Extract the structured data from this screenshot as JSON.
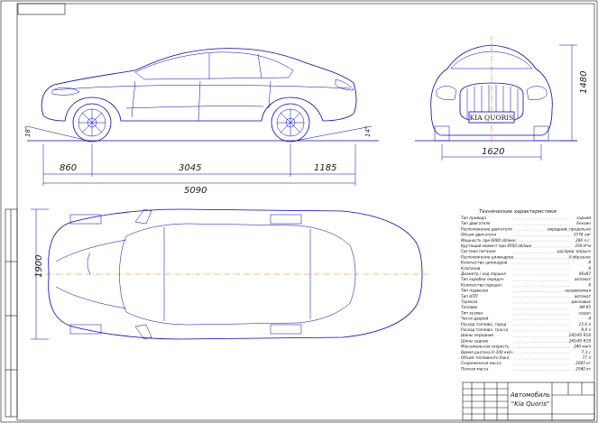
{
  "dimensions": {
    "front_overhang": "860",
    "wheelbase": "3045",
    "rear_overhang": "1185",
    "overall_length": "5090",
    "track": "1620",
    "height": "1480",
    "width": "1900",
    "approach_angle": "18°",
    "departure_angle": "14°"
  },
  "front_view": {
    "plate_text": "KIA QUORIS"
  },
  "specs": {
    "title": "Технические характеристики",
    "rows": [
      {
        "label": "Тип привода",
        "value": "задний"
      },
      {
        "label": "Тип двигателя",
        "value": "бензин"
      },
      {
        "label": "Расположение двигателя",
        "value": "передний, продольно"
      },
      {
        "label": "Объем двигателя",
        "value": "3778 см³"
      },
      {
        "label": "Мощность при 6000 об/мин",
        "value": "290 л.с."
      },
      {
        "label": "Крутящий момент при 4500 об/мин",
        "value": "358 Н*м"
      },
      {
        "label": "Система питания",
        "value": "распред. впрыск"
      },
      {
        "label": "Расположение цилиндров",
        "value": "V-образное"
      },
      {
        "label": "Количество цилиндров",
        "value": "8"
      },
      {
        "label": "Клапанов",
        "value": "4"
      },
      {
        "label": "Диаметр / ход поршня",
        "value": "96x87"
      },
      {
        "label": "Тип коробки передач",
        "value": "автомат"
      },
      {
        "label": "Количество передач",
        "value": "8"
      },
      {
        "label": "Тип подвески",
        "value": "независимая"
      },
      {
        "label": "Тип КПП",
        "value": "автомат"
      },
      {
        "label": "Тормоза",
        "value": "дисковые"
      },
      {
        "label": "Топливо",
        "value": "АИ-95"
      },
      {
        "label": "Тип кузова",
        "value": "седан"
      },
      {
        "label": "Число дверей",
        "value": "4"
      },
      {
        "label": "Расход топлива, город",
        "value": "15,6 л"
      },
      {
        "label": "Расход топлива, трасса",
        "value": "8,4 л"
      },
      {
        "label": "Шины передние",
        "value": "245/45 R18"
      },
      {
        "label": "Шины задние",
        "value": "245/45 R18"
      },
      {
        "label": "Максимальная скорость",
        "value": "240 км/ч"
      },
      {
        "label": "Время разгона 0–100 км/ч",
        "value": "7,3 с"
      },
      {
        "label": "Объем топливного бака",
        "value": "77 л"
      },
      {
        "label": "Снаряженная масса",
        "value": "2005 кг"
      },
      {
        "label": "Полная масса",
        "value": "2540 кг"
      }
    ]
  },
  "title_block": {
    "name": "Автомобиль",
    "model": "\"Kia Quoris\""
  },
  "colors": {
    "line": "#0000cc",
    "axis": "#e07b00",
    "frame": "#111111"
  }
}
